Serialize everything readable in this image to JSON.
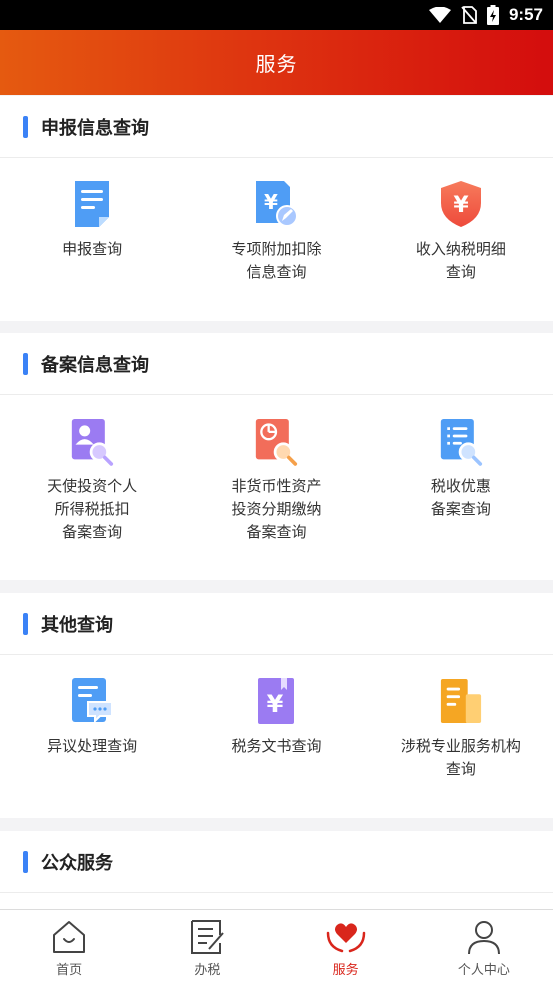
{
  "status_bar": {
    "time": "9:57"
  },
  "header": {
    "title": "服务"
  },
  "sections": [
    {
      "title": "申报信息查询",
      "items": [
        {
          "label": "申报查询",
          "icon": "document-icon"
        },
        {
          "label": "专项附加扣除\n信息查询",
          "icon": "yuan-document-edit-icon"
        },
        {
          "label": "收入纳税明细\n查询",
          "icon": "yuan-shield-icon"
        }
      ]
    },
    {
      "title": "备案信息查询",
      "items": [
        {
          "label": "天使投资个人\n所得税抵扣\n备案查询",
          "icon": "person-search-icon"
        },
        {
          "label": "非货币性资产\n投资分期缴纳\n备案查询",
          "icon": "piechart-search-icon"
        },
        {
          "label": "税收优惠\n备案查询",
          "icon": "list-search-icon"
        }
      ]
    },
    {
      "title": "其他查询",
      "items": [
        {
          "label": "异议处理查询",
          "icon": "message-document-icon"
        },
        {
          "label": "税务文书查询",
          "icon": "yuan-book-icon"
        },
        {
          "label": "涉税专业服务机构\n查询",
          "icon": "building-icon"
        }
      ]
    },
    {
      "title": "公众服务",
      "items": []
    }
  ],
  "tabbar": [
    {
      "label": "首页",
      "icon": "home-icon",
      "active": false
    },
    {
      "label": "办税",
      "icon": "edit-document-icon",
      "active": false
    },
    {
      "label": "服务",
      "icon": "heart-hands-icon",
      "active": true
    },
    {
      "label": "个人中心",
      "icon": "person-icon",
      "active": false
    }
  ],
  "colors": {
    "header_start": "#e55a10",
    "header_end": "#d40d0d",
    "accent_bar": "#3b82f6",
    "active_tab": "#d9261c"
  }
}
